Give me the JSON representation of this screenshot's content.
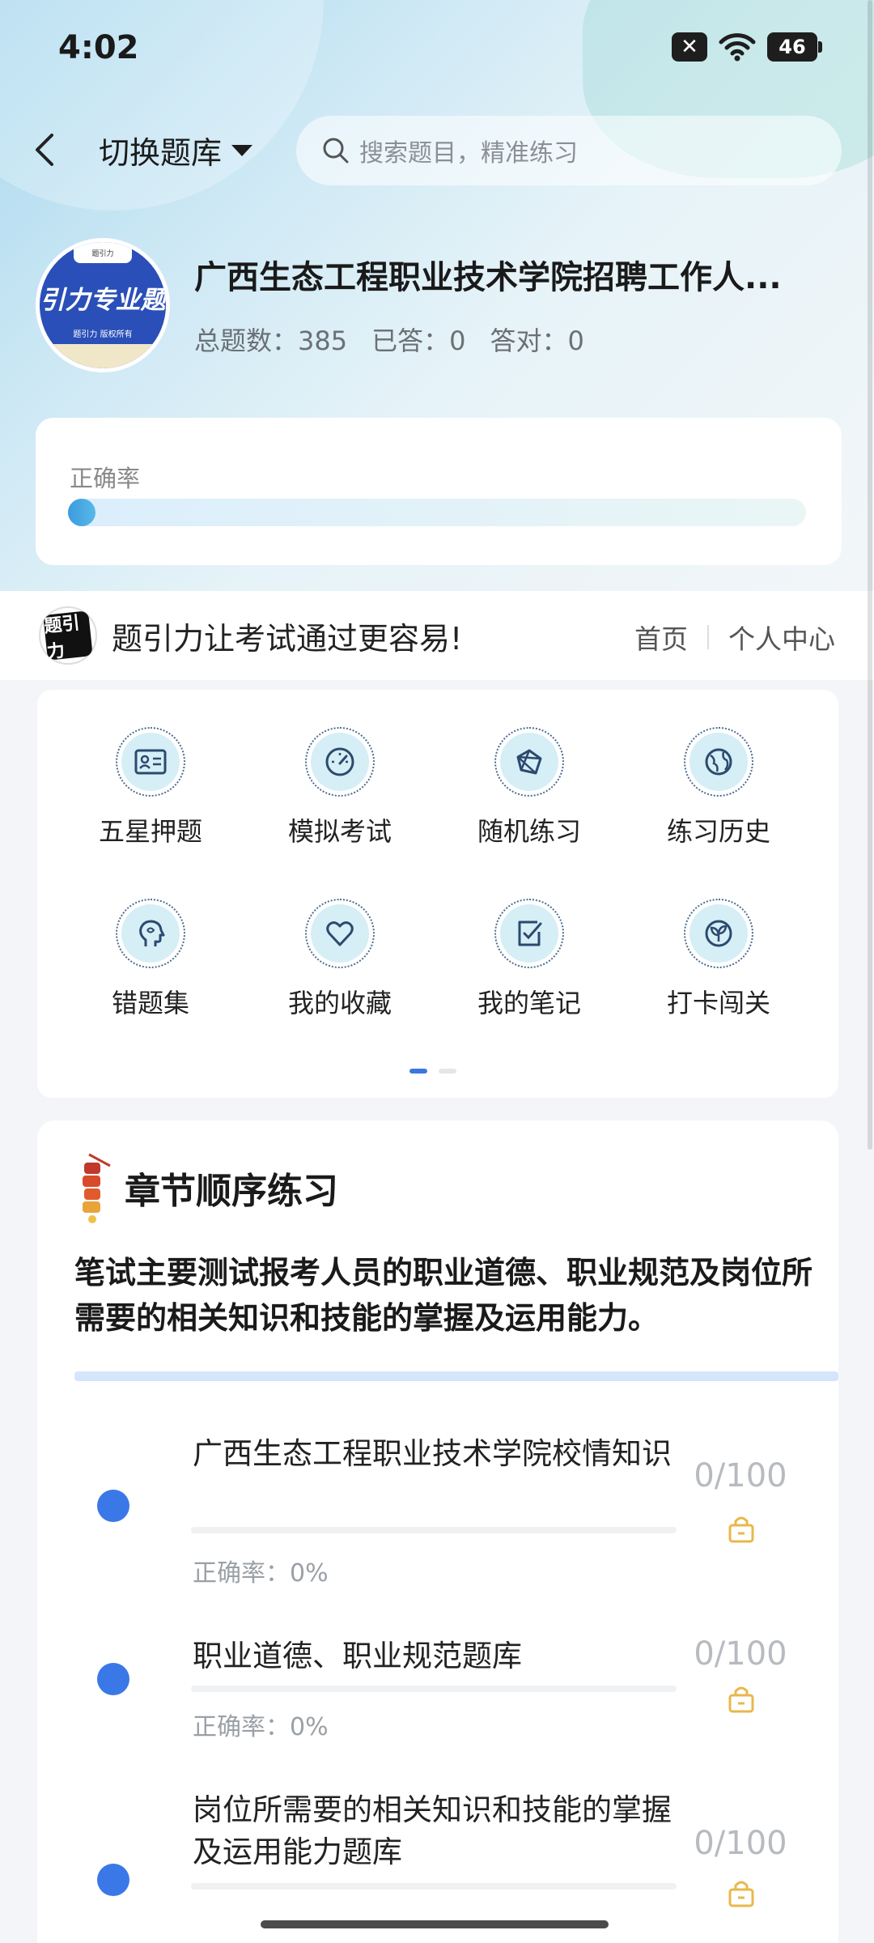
{
  "status_bar": {
    "time": "4:02",
    "battery": "46"
  },
  "header": {
    "switch_label": "切换题库",
    "search_placeholder": "搜索题目，精准练习"
  },
  "bank": {
    "avatar_title": "引力专业题",
    "avatar_tab": "题引力",
    "avatar_sub": "题引力 版权所有",
    "title": "广西生态工程职业技术学院招聘工作人...",
    "total_label": "总题数：385",
    "answered_label": "已答：0",
    "correct_label": "答对：0"
  },
  "accuracy": {
    "label": "正确率",
    "value_fraction": 0.0
  },
  "brand": {
    "logo_text": "题引力",
    "slogan": "题引力让考试通过更容易!",
    "nav_home": "首页",
    "nav_profile": "个人中心"
  },
  "functions": [
    {
      "label": "五星押题",
      "icon": "id-card-icon"
    },
    {
      "label": "模拟考试",
      "icon": "speedometer-icon"
    },
    {
      "label": "随机练习",
      "icon": "network-icon"
    },
    {
      "label": "练习历史",
      "icon": "globe-icon"
    },
    {
      "label": "错题集",
      "icon": "head-icon"
    },
    {
      "label": "我的收藏",
      "icon": "heart-icon"
    },
    {
      "label": "我的笔记",
      "icon": "note-check-icon"
    },
    {
      "label": "打卡闯关",
      "icon": "leaf-icon"
    }
  ],
  "chapter": {
    "title": "章节顺序练习",
    "description": "笔试主要测试报考人员的职业道德、职业规范及岗位所需要的相关知识和技能的掌握及运用能力。",
    "items": [
      {
        "title": "广西生态工程职业技术学院校情知识",
        "accuracy": "正确率：0%",
        "count": "0/100"
      },
      {
        "title": "职业道德、职业规范题库",
        "accuracy": "正确率：0%",
        "count": "0/100"
      },
      {
        "title": "岗位所需要的相关知识和技能的掌握及运用能力题库",
        "accuracy": "",
        "count": "0/100"
      }
    ]
  },
  "colors": {
    "accent": "#3a78e8",
    "lock": "#e8b84a"
  }
}
